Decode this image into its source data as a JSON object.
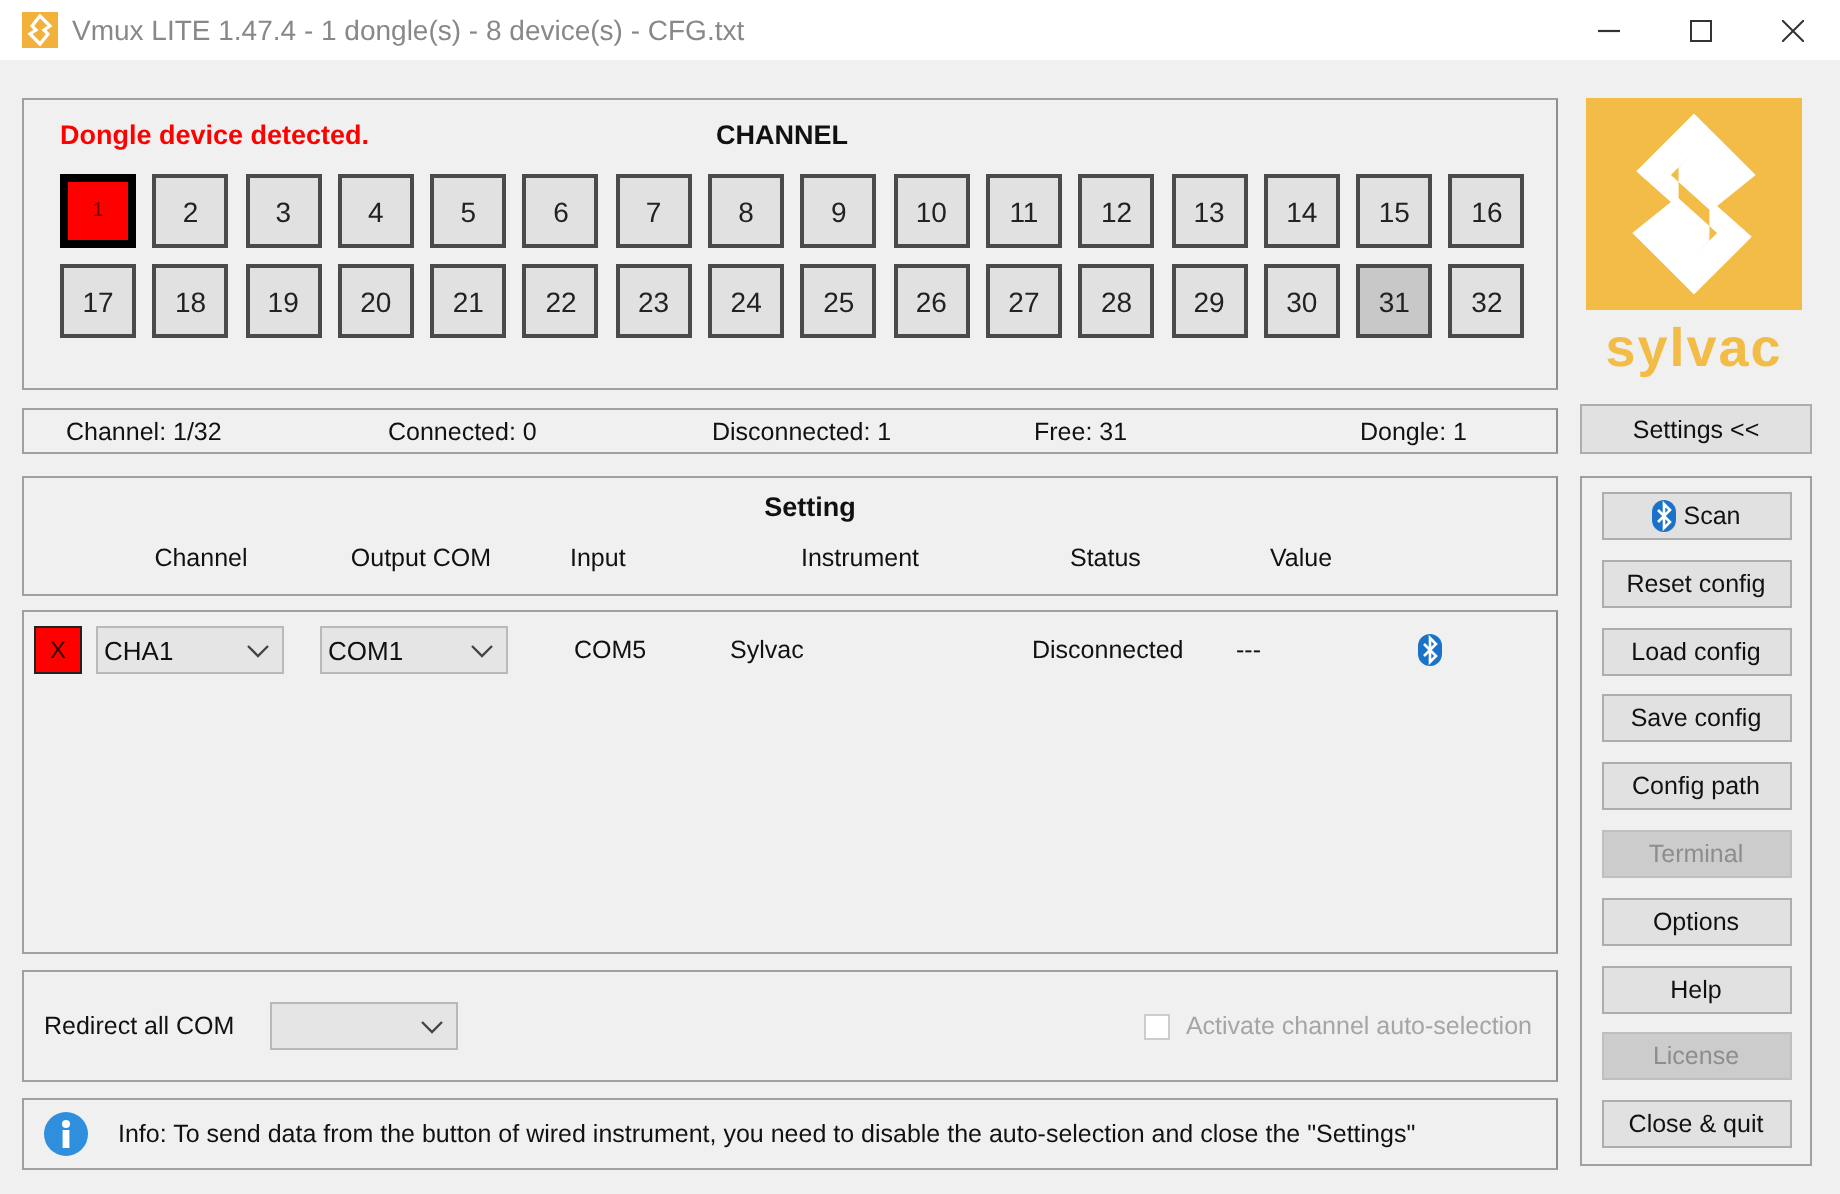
{
  "window": {
    "title": "Vmux LITE 1.47.4 - 1 dongle(s) - 8 device(s) - CFG.txt"
  },
  "channel_panel": {
    "message": "Dongle device detected.",
    "title": "CHANNEL",
    "channels": [
      {
        "label": "1",
        "selected": true,
        "highlighted": false
      },
      {
        "label": "2",
        "selected": false,
        "highlighted": false
      },
      {
        "label": "3",
        "selected": false,
        "highlighted": false
      },
      {
        "label": "4",
        "selected": false,
        "highlighted": false
      },
      {
        "label": "5",
        "selected": false,
        "highlighted": false
      },
      {
        "label": "6",
        "selected": false,
        "highlighted": false
      },
      {
        "label": "7",
        "selected": false,
        "highlighted": false
      },
      {
        "label": "8",
        "selected": false,
        "highlighted": false
      },
      {
        "label": "9",
        "selected": false,
        "highlighted": false
      },
      {
        "label": "10",
        "selected": false,
        "highlighted": false
      },
      {
        "label": "11",
        "selected": false,
        "highlighted": false
      },
      {
        "label": "12",
        "selected": false,
        "highlighted": false
      },
      {
        "label": "13",
        "selected": false,
        "highlighted": false
      },
      {
        "label": "14",
        "selected": false,
        "highlighted": false
      },
      {
        "label": "15",
        "selected": false,
        "highlighted": false
      },
      {
        "label": "16",
        "selected": false,
        "highlighted": false
      },
      {
        "label": "17",
        "selected": false,
        "highlighted": false
      },
      {
        "label": "18",
        "selected": false,
        "highlighted": false
      },
      {
        "label": "19",
        "selected": false,
        "highlighted": false
      },
      {
        "label": "20",
        "selected": false,
        "highlighted": false
      },
      {
        "label": "21",
        "selected": false,
        "highlighted": false
      },
      {
        "label": "22",
        "selected": false,
        "highlighted": false
      },
      {
        "label": "23",
        "selected": false,
        "highlighted": false
      },
      {
        "label": "24",
        "selected": false,
        "highlighted": false
      },
      {
        "label": "25",
        "selected": false,
        "highlighted": false
      },
      {
        "label": "26",
        "selected": false,
        "highlighted": false
      },
      {
        "label": "27",
        "selected": false,
        "highlighted": false
      },
      {
        "label": "28",
        "selected": false,
        "highlighted": false
      },
      {
        "label": "29",
        "selected": false,
        "highlighted": false
      },
      {
        "label": "30",
        "selected": false,
        "highlighted": false
      },
      {
        "label": "31",
        "selected": false,
        "highlighted": true
      },
      {
        "label": "32",
        "selected": false,
        "highlighted": false
      }
    ]
  },
  "logo": {
    "text": "sylvac"
  },
  "status_bar": [
    "Channel: 1/32",
    "Connected: 0",
    "Disconnected: 1",
    "Free: 31",
    "Dongle: 1"
  ],
  "settings_toggle": "Settings <<",
  "setting": {
    "title": "Setting",
    "columns": [
      "Channel",
      "Output COM",
      "Input",
      "Instrument",
      "Status",
      "Value"
    ],
    "rows": [
      {
        "remove": "X",
        "channel": "CHA1",
        "output_com": "COM1",
        "input": "COM5",
        "instrument": "Sylvac",
        "status": "Disconnected",
        "value": "---",
        "bluetooth": true
      }
    ]
  },
  "redirect": {
    "label": "Redirect all COM",
    "auto_selection": {
      "label": "Activate channel auto-selection",
      "checked": false,
      "disabled": true
    }
  },
  "info": "Info: To send data from the button of wired instrument, you need to disable the auto-selection and close the \"Settings\"",
  "buttons": [
    {
      "label": "Scan",
      "kind": "bluetooth",
      "disabled": false
    },
    {
      "label": "Reset config",
      "kind": "plain",
      "disabled": false
    },
    {
      "label": "Load config",
      "kind": "plain",
      "disabled": false
    },
    {
      "label": "Save config",
      "kind": "plain",
      "disabled": false
    },
    {
      "label": "Config path",
      "kind": "plain",
      "disabled": false
    },
    {
      "label": "Terminal",
      "kind": "plain",
      "disabled": true
    },
    {
      "label": "Options",
      "kind": "plain",
      "disabled": false
    },
    {
      "label": "Help",
      "kind": "plain",
      "disabled": false
    },
    {
      "label": "License",
      "kind": "plain",
      "disabled": true
    },
    {
      "label": "Close & quit",
      "kind": "plain",
      "disabled": false
    }
  ]
}
